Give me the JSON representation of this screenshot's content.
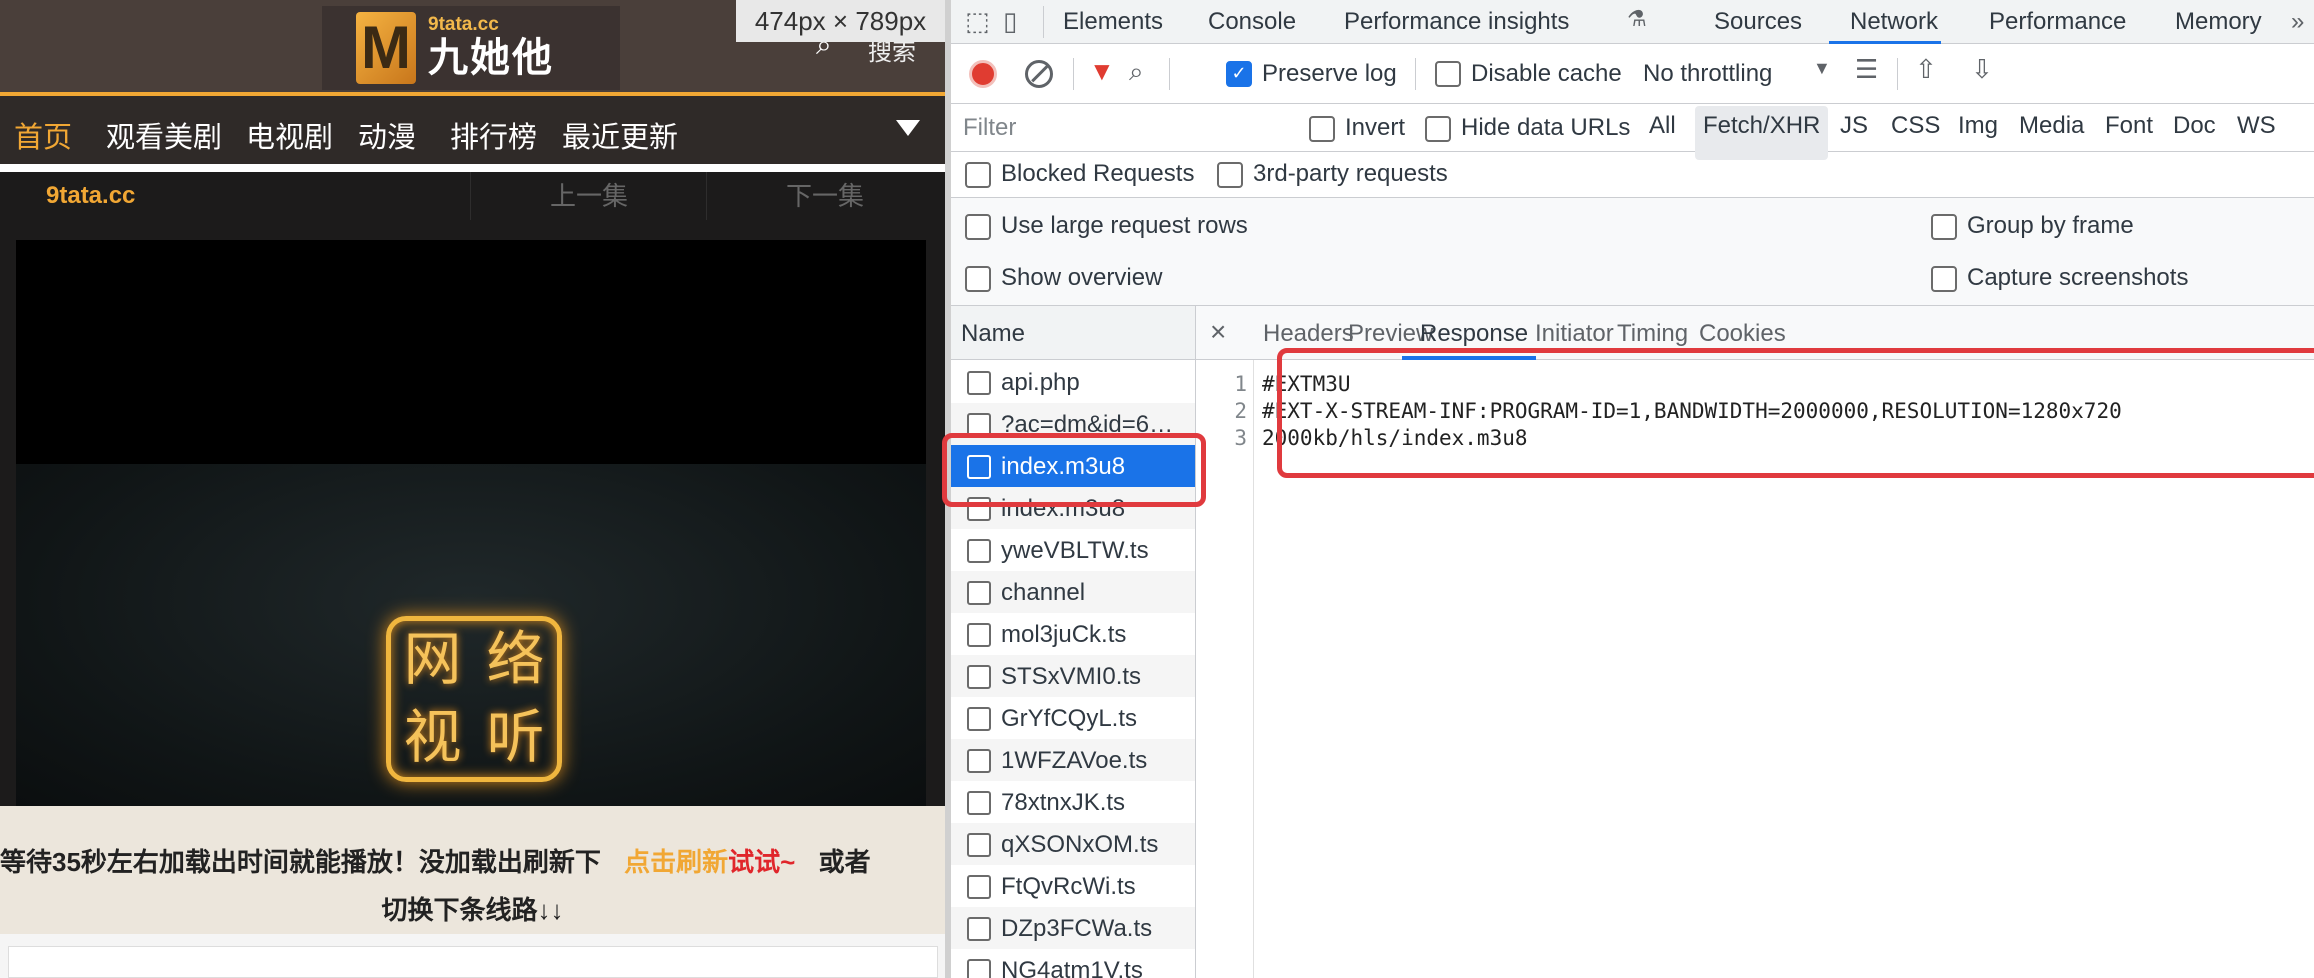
{
  "site": {
    "logo": {
      "domain": "9tata.cc",
      "name": "九她他",
      "mark": "M"
    },
    "search_label": "搜索",
    "dimension_badge": "474px × 789px",
    "nav": [
      "首页",
      "观看美剧",
      "电视剧",
      "动漫",
      "排行榜",
      "最近更新"
    ],
    "episode_bar": {
      "site": "9tata.cc",
      "prev": "上一集",
      "next": "下一集"
    },
    "player_seal": [
      "网",
      "络",
      "视",
      "听"
    ],
    "notice": {
      "part1": "等待35秒左右加载出时间就能播放！没加载出刷新下",
      "link_a": "点击刷新",
      "link_b": "试试~",
      "part2": "或者",
      "line2": "切换下条线路↓↓"
    }
  },
  "devtools": {
    "tabs": [
      "Elements",
      "Console",
      "Performance insights",
      "Sources",
      "Network",
      "Performance",
      "Memory"
    ],
    "active_tab": "Network",
    "toolbar": {
      "preserve_log": "Preserve log",
      "disable_cache": "Disable cache",
      "throttling": "No throttling"
    },
    "filter": {
      "placeholder": "Filter",
      "invert": "Invert",
      "hide_data_urls": "Hide data URLs",
      "types": [
        "All",
        "Fetch/XHR",
        "JS",
        "CSS",
        "Img",
        "Media",
        "Font",
        "Doc",
        "WS"
      ],
      "active_type": "Fetch/XHR"
    },
    "row3": {
      "blocked": "Blocked Requests",
      "third_party": "3rd-party requests"
    },
    "settings": {
      "large_rows": "Use large request rows",
      "show_overview": "Show overview",
      "group_by_frame": "Group by frame",
      "capture_screenshots": "Capture screenshots"
    },
    "requests": {
      "header": "Name",
      "items": [
        "api.php",
        "?ac=dm&id=6…",
        "index.m3u8",
        "index.m3u8",
        "yweVBLTW.ts",
        "channel",
        "mol3juCk.ts",
        "STSxVMI0.ts",
        "GrYfCQyL.ts",
        "1WFZAVoe.ts",
        "78xtnxJK.ts",
        "qXSONxOM.ts",
        "FtQvRcWi.ts",
        "DZp3FCWa.ts",
        "NG4atm1V.ts"
      ],
      "selected_index": 2
    },
    "detail_tabs": [
      "Headers",
      "Preview",
      "Response",
      "Initiator",
      "Timing",
      "Cookies"
    ],
    "active_detail_tab": "Response",
    "response_lines": [
      {
        "n": "1",
        "text": "#EXTM3U"
      },
      {
        "n": "2",
        "text": "#EXT-X-STREAM-INF:PROGRAM-ID=1,BANDWIDTH=2000000,RESOLUTION=1280x720"
      },
      {
        "n": "3",
        "text": "2000kb/hls/index.m3u8"
      }
    ]
  },
  "colors": {
    "accent": "#1a73e8",
    "highlight": "#e03a3e",
    "site_orange": "#f1a734"
  }
}
